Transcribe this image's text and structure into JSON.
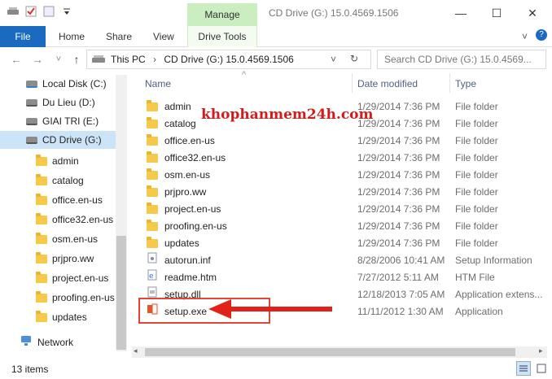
{
  "window": {
    "title": "CD Drive (G:) 15.0.4569.1506",
    "manage_tab": "Manage",
    "minimize": "—",
    "maximize": "☐",
    "close": "✕"
  },
  "ribbon": {
    "file": "File",
    "home": "Home",
    "share": "Share",
    "view": "View",
    "drive_tools": "Drive Tools",
    "chevron": "˅",
    "help": "?"
  },
  "nav": {
    "back": "←",
    "forward": "→",
    "recent": "˅",
    "up": "↑",
    "breadcrumb_this_pc": "This PC",
    "breadcrumb_sep": "›",
    "breadcrumb_drive": "CD Drive (G:) 15.0.4569.1506",
    "search_placeholder": "Search CD Drive (G:) 15.0.4569..."
  },
  "sidebar": {
    "drives": [
      {
        "label": "Local Disk (C:)"
      },
      {
        "label": "Du Lieu (D:)"
      },
      {
        "label": "GIAI TRI (E:)"
      },
      {
        "label": "CD Drive (G:)"
      }
    ],
    "folders": [
      {
        "label": "admin"
      },
      {
        "label": "catalog"
      },
      {
        "label": "office.en-us"
      },
      {
        "label": "office32.en-us"
      },
      {
        "label": "osm.en-us"
      },
      {
        "label": "prjpro.ww"
      },
      {
        "label": "project.en-us"
      },
      {
        "label": "proofing.en-us"
      },
      {
        "label": "updates"
      }
    ],
    "network": "Network"
  },
  "columns": {
    "name": "Name",
    "date": "Date modified",
    "type": "Type",
    "sort_arrow": "^"
  },
  "files": [
    {
      "name": "admin",
      "date": "1/29/2014 7:36 PM",
      "type": "File folder",
      "icon": "folder-icon"
    },
    {
      "name": "catalog",
      "date": "1/29/2014 7:36 PM",
      "type": "File folder",
      "icon": "folder-icon"
    },
    {
      "name": "office.en-us",
      "date": "1/29/2014 7:36 PM",
      "type": "File folder",
      "icon": "folder-icon"
    },
    {
      "name": "office32.en-us",
      "date": "1/29/2014 7:36 PM",
      "type": "File folder",
      "icon": "folder-icon"
    },
    {
      "name": "osm.en-us",
      "date": "1/29/2014 7:36 PM",
      "type": "File folder",
      "icon": "folder-icon"
    },
    {
      "name": "prjpro.ww",
      "date": "1/29/2014 7:36 PM",
      "type": "File folder",
      "icon": "folder-icon"
    },
    {
      "name": "project.en-us",
      "date": "1/29/2014 7:36 PM",
      "type": "File folder",
      "icon": "folder-icon"
    },
    {
      "name": "proofing.en-us",
      "date": "1/29/2014 7:36 PM",
      "type": "File folder",
      "icon": "folder-icon"
    },
    {
      "name": "updates",
      "date": "1/29/2014 7:36 PM",
      "type": "File folder",
      "icon": "folder-icon"
    },
    {
      "name": "autorun.inf",
      "date": "8/28/2006 10:41 AM",
      "type": "Setup Information",
      "icon": "setup-info-icon"
    },
    {
      "name": "readme.htm",
      "date": "7/27/2012 5:11 AM",
      "type": "HTM File",
      "icon": "html-file-icon"
    },
    {
      "name": "setup.dll",
      "date": "12/18/2013 7:05 AM",
      "type": "Application extens...",
      "icon": "dll-icon"
    },
    {
      "name": "setup.exe",
      "date": "11/11/2012 1:30 AM",
      "type": "Application",
      "icon": "office-setup-icon"
    }
  ],
  "status": {
    "items": "13 items"
  },
  "watermark": "khophanmem24h.com",
  "colors": {
    "accent": "#1a6ac0",
    "manage": "#cbeec0",
    "annotation": "#e22119"
  }
}
